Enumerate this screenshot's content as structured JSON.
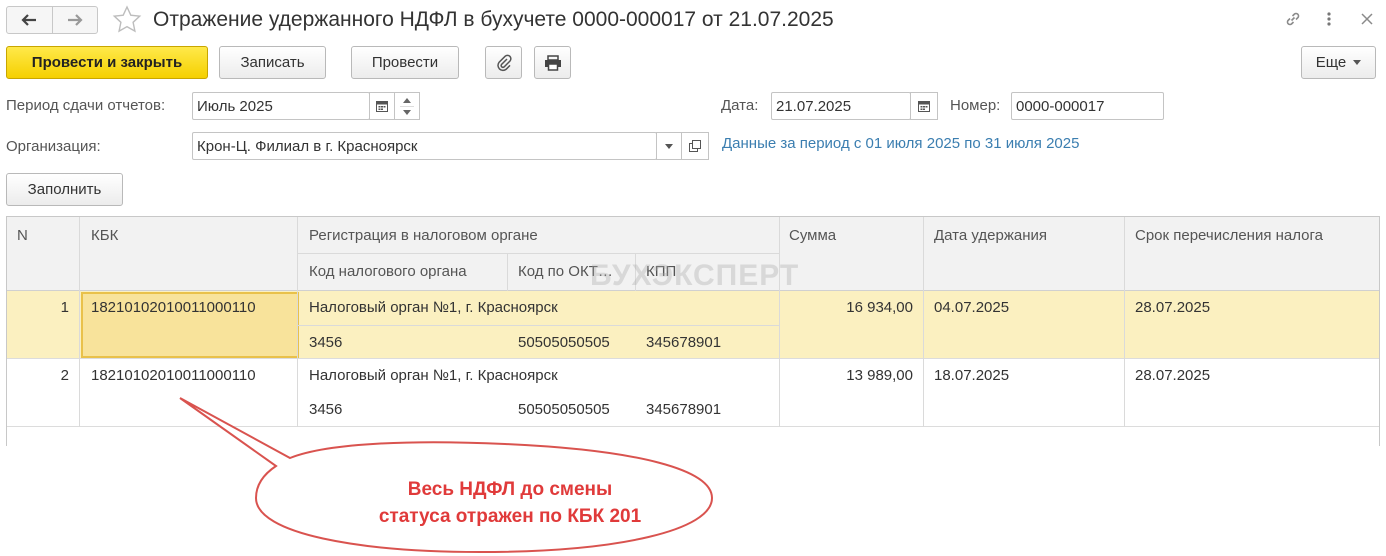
{
  "window": {
    "title": "Отражение удержанного НДФЛ в бухучете 0000-000017 от 21.07.2025"
  },
  "toolbar": {
    "post_close": "Провести и закрыть",
    "save": "Записать",
    "post": "Провести",
    "more": "Еще"
  },
  "form": {
    "period_label": "Период сдачи отчетов:",
    "period_value": "Июль 2025",
    "date_label": "Дата:",
    "date_value": "21.07.2025",
    "number_label": "Номер:",
    "number_value": "0000-000017",
    "org_label": "Организация:",
    "org_value": "Крон-Ц. Филиал в г. Красноярск",
    "period_info": "Данные за период с 01 июля 2025 по 31 июля 2025",
    "fill_button": "Заполнить"
  },
  "table": {
    "headers": {
      "n": "N",
      "kbk": "КБК",
      "registration": "Регистрация в налоговом органе",
      "tax_office_code": "Код налогового органа",
      "oktmo": "Код по ОКТ…",
      "kpp": "КПП",
      "sum": "Сумма",
      "withhold_date": "Дата удержания",
      "transfer_deadline": "Срок перечисления налога"
    },
    "rows": [
      {
        "n": "1",
        "kbk": "18210102010011000110",
        "tax_office": "Налоговый орган №1, г. Красноярск",
        "tax_office_code": "3456",
        "oktmo": "50505050505",
        "kpp": "345678901",
        "sum": "16 934,00",
        "withhold_date": "04.07.2025",
        "transfer_deadline": "28.07.2025"
      },
      {
        "n": "2",
        "kbk": "18210102010011000110",
        "tax_office": "Налоговый орган №1, г. Красноярск",
        "tax_office_code": "3456",
        "oktmo": "50505050505",
        "kpp": "345678901",
        "sum": "13 989,00",
        "withhold_date": "18.07.2025",
        "transfer_deadline": "28.07.2025"
      }
    ]
  },
  "watermark": "БУХЭКСПЕРТ",
  "callout": {
    "line1": "Весь НДФЛ до смены",
    "line2": "статуса отражен по КБК 201"
  },
  "colors": {
    "primary_button": "#f5d000",
    "selected_row": "#fbf0c0",
    "link": "#3b7eb0",
    "callout": "#e03a3a"
  }
}
